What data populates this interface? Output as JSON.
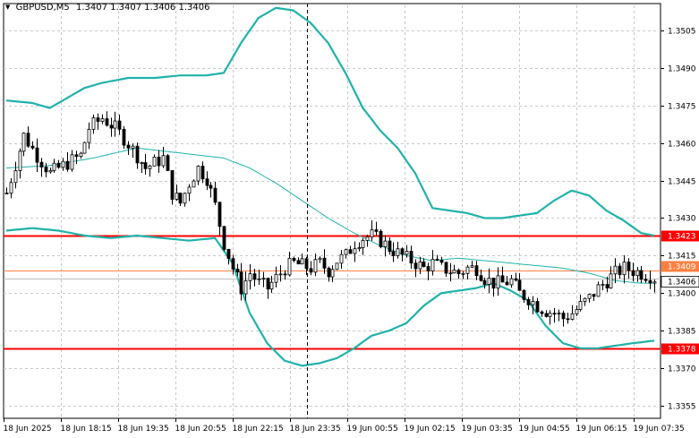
{
  "window": {
    "title": "GBPUSD,M5",
    "ohlc": "1.3407 1.3407 1.3406 1.3406"
  },
  "colors": {
    "background": "#ffffff",
    "grid": "#c8c8c8",
    "candle": "#000000",
    "bollinger": "#20b2aa",
    "level": "#ff0000",
    "bid_line": "#ff8040",
    "ask_line": "#c0c0c0"
  },
  "chart_data": {
    "type": "candlestick",
    "symbol": "GBPUSD",
    "timeframe": "M5",
    "ylim": [
      1.335,
      1.3515
    ],
    "y_ticks": [
      "1.3505",
      "1.3490",
      "1.3475",
      "1.3460",
      "1.3445",
      "1.3430",
      "1.3415",
      "1.3400",
      "1.3385",
      "1.3370",
      "1.3355"
    ],
    "x_ticks": [
      "18 Jun 2025",
      "18 Jun 18:15",
      "18 Jun 19:35",
      "18 Jun 20:55",
      "18 Jun 22:15",
      "18 Jun 23:35",
      "19 Jun 00:55",
      "19 Jun 02:15",
      "19 Jun 03:35",
      "19 Jun 04:55",
      "19 Jun 06:15",
      "19 Jun 07:35"
    ],
    "grid": true,
    "horizontal_levels": [
      {
        "label": "1.3423",
        "value": 1.3423,
        "color": "#ff0000"
      },
      {
        "label": "1.3378",
        "value": 1.3378,
        "color": "#ff0000"
      }
    ],
    "price_markers": [
      {
        "label": "1.3409",
        "value": 1.3409,
        "color": "#ff8040"
      },
      {
        "label": "1.3406",
        "value": 1.3406,
        "color": "#ffffff"
      }
    ],
    "crosshair_vertical_at": "18 Jun 23:35",
    "close_path": [
      [
        0,
        1.344
      ],
      [
        4,
        1.3463
      ],
      [
        7,
        1.3455
      ],
      [
        10,
        1.3448
      ],
      [
        14,
        1.3452
      ],
      [
        17,
        1.3455
      ],
      [
        19,
        1.3466
      ],
      [
        22,
        1.347
      ],
      [
        25,
        1.3466
      ],
      [
        27,
        1.3462
      ],
      [
        30,
        1.3455
      ],
      [
        32,
        1.345
      ],
      [
        34,
        1.3452
      ],
      [
        36,
        1.3454
      ],
      [
        38,
        1.344
      ],
      [
        40,
        1.3436
      ],
      [
        42,
        1.3444
      ],
      [
        44,
        1.345
      ],
      [
        46,
        1.3446
      ],
      [
        48,
        1.3435
      ],
      [
        50,
        1.342
      ],
      [
        52,
        1.341
      ],
      [
        54,
        1.3402
      ],
      [
        56,
        1.3408
      ],
      [
        58,
        1.3404
      ],
      [
        60,
        1.3402
      ],
      [
        62,
        1.3406
      ],
      [
        64,
        1.341
      ],
      [
        66,
        1.3412
      ],
      [
        68,
        1.3411
      ],
      [
        70,
        1.341
      ],
      [
        72,
        1.3412
      ],
      [
        74,
        1.3409
      ],
      [
        76,
        1.3413
      ],
      [
        78,
        1.3415
      ],
      [
        80,
        1.342
      ],
      [
        82,
        1.3422
      ],
      [
        84,
        1.3423
      ],
      [
        86,
        1.3421
      ],
      [
        88,
        1.3418
      ],
      [
        90,
        1.3416
      ],
      [
        92,
        1.3414
      ],
      [
        94,
        1.3412
      ],
      [
        96,
        1.341
      ],
      [
        98,
        1.3412
      ],
      [
        100,
        1.341
      ],
      [
        102,
        1.3409
      ],
      [
        104,
        1.3408
      ],
      [
        106,
        1.341
      ],
      [
        108,
        1.341
      ],
      [
        110,
        1.3406
      ],
      [
        112,
        1.3404
      ],
      [
        114,
        1.3404
      ],
      [
        116,
        1.3405
      ],
      [
        118,
        1.34
      ],
      [
        120,
        1.3398
      ],
      [
        122,
        1.3395
      ],
      [
        124,
        1.3393
      ],
      [
        126,
        1.3392
      ],
      [
        128,
        1.339
      ],
      [
        130,
        1.3392
      ],
      [
        132,
        1.3395
      ],
      [
        134,
        1.3398
      ],
      [
        136,
        1.3402
      ],
      [
        138,
        1.3405
      ],
      [
        140,
        1.3408
      ],
      [
        142,
        1.341
      ],
      [
        144,
        1.3409
      ],
      [
        146,
        1.3408
      ],
      [
        148,
        1.3407
      ],
      [
        149,
        1.3406
      ]
    ],
    "bollinger_upper": [
      [
        0,
        1.3477
      ],
      [
        6,
        1.3476
      ],
      [
        10,
        1.3474
      ],
      [
        14,
        1.3478
      ],
      [
        18,
        1.3482
      ],
      [
        22,
        1.3484
      ],
      [
        28,
        1.3486
      ],
      [
        34,
        1.3486
      ],
      [
        40,
        1.3487
      ],
      [
        46,
        1.3487
      ],
      [
        50,
        1.3488
      ],
      [
        54,
        1.35
      ],
      [
        58,
        1.351
      ],
      [
        62,
        1.3514
      ],
      [
        66,
        1.3513
      ],
      [
        70,
        1.3508
      ],
      [
        74,
        1.35
      ],
      [
        78,
        1.3488
      ],
      [
        82,
        1.3474
      ],
      [
        86,
        1.3465
      ],
      [
        90,
        1.3458
      ],
      [
        94,
        1.3448
      ],
      [
        98,
        1.3434
      ],
      [
        102,
        1.3433
      ],
      [
        106,
        1.3432
      ],
      [
        110,
        1.343
      ],
      [
        114,
        1.343
      ],
      [
        118,
        1.3431
      ],
      [
        122,
        1.3432
      ],
      [
        126,
        1.3437
      ],
      [
        130,
        1.3441
      ],
      [
        134,
        1.3439
      ],
      [
        138,
        1.3433
      ],
      [
        142,
        1.3429
      ],
      [
        146,
        1.3424
      ],
      [
        149,
        1.3423
      ]
    ],
    "bollinger_mid": [
      [
        0,
        1.345
      ],
      [
        10,
        1.3451
      ],
      [
        20,
        1.3454
      ],
      [
        30,
        1.3458
      ],
      [
        40,
        1.3456
      ],
      [
        50,
        1.3454
      ],
      [
        56,
        1.345
      ],
      [
        62,
        1.3444
      ],
      [
        68,
        1.3437
      ],
      [
        74,
        1.343
      ],
      [
        80,
        1.3424
      ],
      [
        86,
        1.3419
      ],
      [
        92,
        1.3415
      ],
      [
        98,
        1.3413
      ],
      [
        104,
        1.3414
      ],
      [
        110,
        1.3413
      ],
      [
        116,
        1.3412
      ],
      [
        122,
        1.3411
      ],
      [
        128,
        1.341
      ],
      [
        134,
        1.3408
      ],
      [
        140,
        1.3405
      ],
      [
        146,
        1.3404
      ],
      [
        149,
        1.3404
      ]
    ],
    "bollinger_lower": [
      [
        0,
        1.3425
      ],
      [
        6,
        1.3426
      ],
      [
        12,
        1.3425
      ],
      [
        18,
        1.3423
      ],
      [
        24,
        1.3422
      ],
      [
        30,
        1.3423
      ],
      [
        36,
        1.3422
      ],
      [
        42,
        1.3421
      ],
      [
        48,
        1.3422
      ],
      [
        52,
        1.3412
      ],
      [
        56,
        1.3392
      ],
      [
        60,
        1.338
      ],
      [
        64,
        1.3373
      ],
      [
        68,
        1.3371
      ],
      [
        72,
        1.3372
      ],
      [
        76,
        1.3374
      ],
      [
        80,
        1.3378
      ],
      [
        84,
        1.3383
      ],
      [
        88,
        1.3385
      ],
      [
        92,
        1.3388
      ],
      [
        96,
        1.3395
      ],
      [
        100,
        1.34
      ],
      [
        104,
        1.3401
      ],
      [
        108,
        1.3402
      ],
      [
        112,
        1.3404
      ],
      [
        116,
        1.3401
      ],
      [
        120,
        1.3397
      ],
      [
        124,
        1.3387
      ],
      [
        128,
        1.338
      ],
      [
        132,
        1.3378
      ],
      [
        136,
        1.3378
      ],
      [
        140,
        1.3379
      ],
      [
        144,
        1.338
      ],
      [
        149,
        1.3381
      ]
    ]
  }
}
